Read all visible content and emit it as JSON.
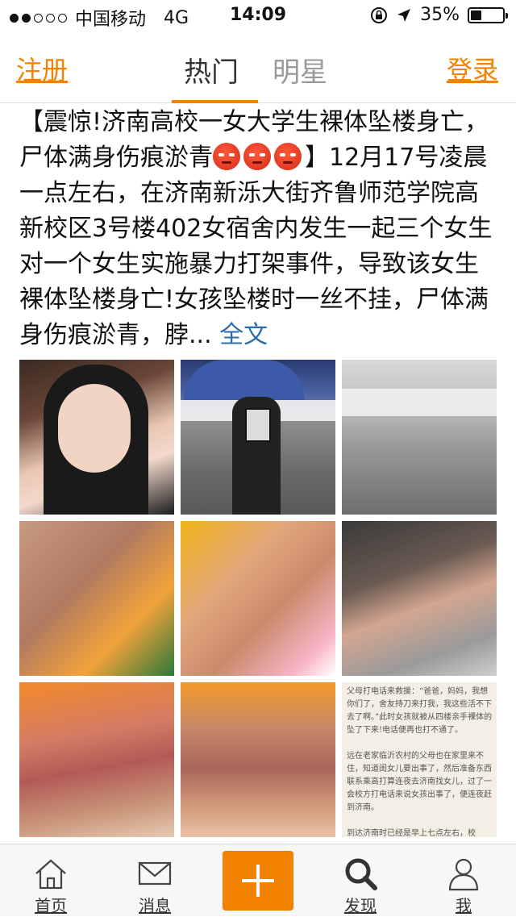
{
  "status": {
    "carrier": "中国移动",
    "network": "4G",
    "time": "14:09",
    "battery": "35%",
    "battery_level": 0.35
  },
  "nav": {
    "register": "注册",
    "tab_hot": "热门",
    "tab_stars": "明星",
    "login": "登录",
    "accent": "#f38200"
  },
  "post": {
    "text1": "【震惊!济南高校一女大学生裸体坠楼身亡，尸体满身伤痕淤青",
    "text2": "】12月17号凌晨一点左右，在济南新泺大街齐鲁师范学院高新校区3号楼402女宿舍内发生一起三个女生对一个女生实施暴力打架事件，导致该女生裸体坠楼身亡!女孩坠楼时一丝不挂，尸体满身伤痕淤青，脖... ",
    "more": "全文"
  },
  "images": {
    "doc_text": "父母打电话来救援：“爸爸，妈妈，我想你们了，舍友持刀来打我，我这些活不下去了啊。”此时女孩就被从四楼亲手裸体的坠了下来!电话便再也打不通了。\n\n远在老家临沂农村的父母也在家里来不住，知道闺女儿要出事了，然后准备东西联系乘高打算连夜去济南找女儿，过了一会校方打电话来说女孩出事了，便连夜赶到济南。\n\n到达济南时已经是早上七点左右，校"
  },
  "tabbar": {
    "home": "首页",
    "messages": "消息",
    "discover": "发现",
    "me": "我"
  }
}
